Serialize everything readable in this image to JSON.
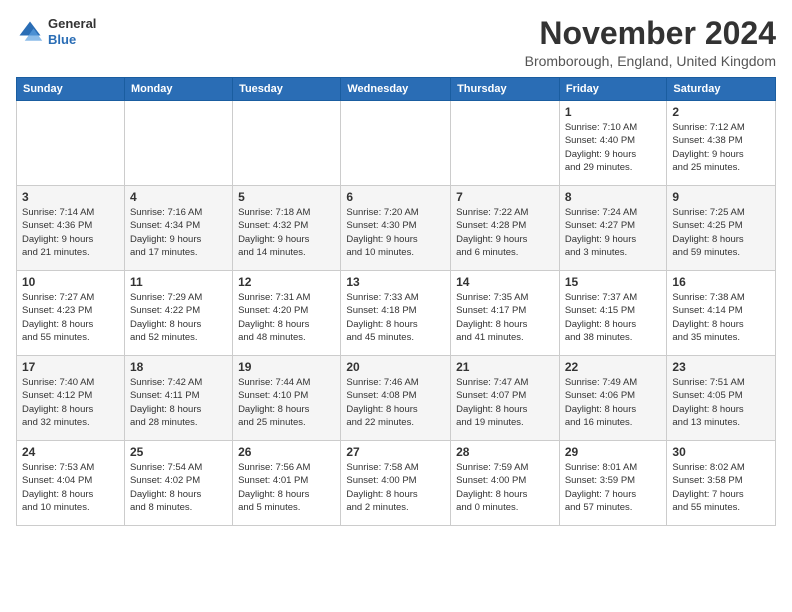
{
  "logo": {
    "line1": "General",
    "line2": "Blue"
  },
  "title": "November 2024",
  "location": "Bromborough, England, United Kingdom",
  "days_of_week": [
    "Sunday",
    "Monday",
    "Tuesday",
    "Wednesday",
    "Thursday",
    "Friday",
    "Saturday"
  ],
  "weeks": [
    [
      {
        "num": "",
        "info": ""
      },
      {
        "num": "",
        "info": ""
      },
      {
        "num": "",
        "info": ""
      },
      {
        "num": "",
        "info": ""
      },
      {
        "num": "",
        "info": ""
      },
      {
        "num": "1",
        "info": "Sunrise: 7:10 AM\nSunset: 4:40 PM\nDaylight: 9 hours\nand 29 minutes."
      },
      {
        "num": "2",
        "info": "Sunrise: 7:12 AM\nSunset: 4:38 PM\nDaylight: 9 hours\nand 25 minutes."
      }
    ],
    [
      {
        "num": "3",
        "info": "Sunrise: 7:14 AM\nSunset: 4:36 PM\nDaylight: 9 hours\nand 21 minutes."
      },
      {
        "num": "4",
        "info": "Sunrise: 7:16 AM\nSunset: 4:34 PM\nDaylight: 9 hours\nand 17 minutes."
      },
      {
        "num": "5",
        "info": "Sunrise: 7:18 AM\nSunset: 4:32 PM\nDaylight: 9 hours\nand 14 minutes."
      },
      {
        "num": "6",
        "info": "Sunrise: 7:20 AM\nSunset: 4:30 PM\nDaylight: 9 hours\nand 10 minutes."
      },
      {
        "num": "7",
        "info": "Sunrise: 7:22 AM\nSunset: 4:28 PM\nDaylight: 9 hours\nand 6 minutes."
      },
      {
        "num": "8",
        "info": "Sunrise: 7:24 AM\nSunset: 4:27 PM\nDaylight: 9 hours\nand 3 minutes."
      },
      {
        "num": "9",
        "info": "Sunrise: 7:25 AM\nSunset: 4:25 PM\nDaylight: 8 hours\nand 59 minutes."
      }
    ],
    [
      {
        "num": "10",
        "info": "Sunrise: 7:27 AM\nSunset: 4:23 PM\nDaylight: 8 hours\nand 55 minutes."
      },
      {
        "num": "11",
        "info": "Sunrise: 7:29 AM\nSunset: 4:22 PM\nDaylight: 8 hours\nand 52 minutes."
      },
      {
        "num": "12",
        "info": "Sunrise: 7:31 AM\nSunset: 4:20 PM\nDaylight: 8 hours\nand 48 minutes."
      },
      {
        "num": "13",
        "info": "Sunrise: 7:33 AM\nSunset: 4:18 PM\nDaylight: 8 hours\nand 45 minutes."
      },
      {
        "num": "14",
        "info": "Sunrise: 7:35 AM\nSunset: 4:17 PM\nDaylight: 8 hours\nand 41 minutes."
      },
      {
        "num": "15",
        "info": "Sunrise: 7:37 AM\nSunset: 4:15 PM\nDaylight: 8 hours\nand 38 minutes."
      },
      {
        "num": "16",
        "info": "Sunrise: 7:38 AM\nSunset: 4:14 PM\nDaylight: 8 hours\nand 35 minutes."
      }
    ],
    [
      {
        "num": "17",
        "info": "Sunrise: 7:40 AM\nSunset: 4:12 PM\nDaylight: 8 hours\nand 32 minutes."
      },
      {
        "num": "18",
        "info": "Sunrise: 7:42 AM\nSunset: 4:11 PM\nDaylight: 8 hours\nand 28 minutes."
      },
      {
        "num": "19",
        "info": "Sunrise: 7:44 AM\nSunset: 4:10 PM\nDaylight: 8 hours\nand 25 minutes."
      },
      {
        "num": "20",
        "info": "Sunrise: 7:46 AM\nSunset: 4:08 PM\nDaylight: 8 hours\nand 22 minutes."
      },
      {
        "num": "21",
        "info": "Sunrise: 7:47 AM\nSunset: 4:07 PM\nDaylight: 8 hours\nand 19 minutes."
      },
      {
        "num": "22",
        "info": "Sunrise: 7:49 AM\nSunset: 4:06 PM\nDaylight: 8 hours\nand 16 minutes."
      },
      {
        "num": "23",
        "info": "Sunrise: 7:51 AM\nSunset: 4:05 PM\nDaylight: 8 hours\nand 13 minutes."
      }
    ],
    [
      {
        "num": "24",
        "info": "Sunrise: 7:53 AM\nSunset: 4:04 PM\nDaylight: 8 hours\nand 10 minutes."
      },
      {
        "num": "25",
        "info": "Sunrise: 7:54 AM\nSunset: 4:02 PM\nDaylight: 8 hours\nand 8 minutes."
      },
      {
        "num": "26",
        "info": "Sunrise: 7:56 AM\nSunset: 4:01 PM\nDaylight: 8 hours\nand 5 minutes."
      },
      {
        "num": "27",
        "info": "Sunrise: 7:58 AM\nSunset: 4:00 PM\nDaylight: 8 hours\nand 2 minutes."
      },
      {
        "num": "28",
        "info": "Sunrise: 7:59 AM\nSunset: 4:00 PM\nDaylight: 8 hours\nand 0 minutes."
      },
      {
        "num": "29",
        "info": "Sunrise: 8:01 AM\nSunset: 3:59 PM\nDaylight: 7 hours\nand 57 minutes."
      },
      {
        "num": "30",
        "info": "Sunrise: 8:02 AM\nSunset: 3:58 PM\nDaylight: 7 hours\nand 55 minutes."
      }
    ]
  ]
}
